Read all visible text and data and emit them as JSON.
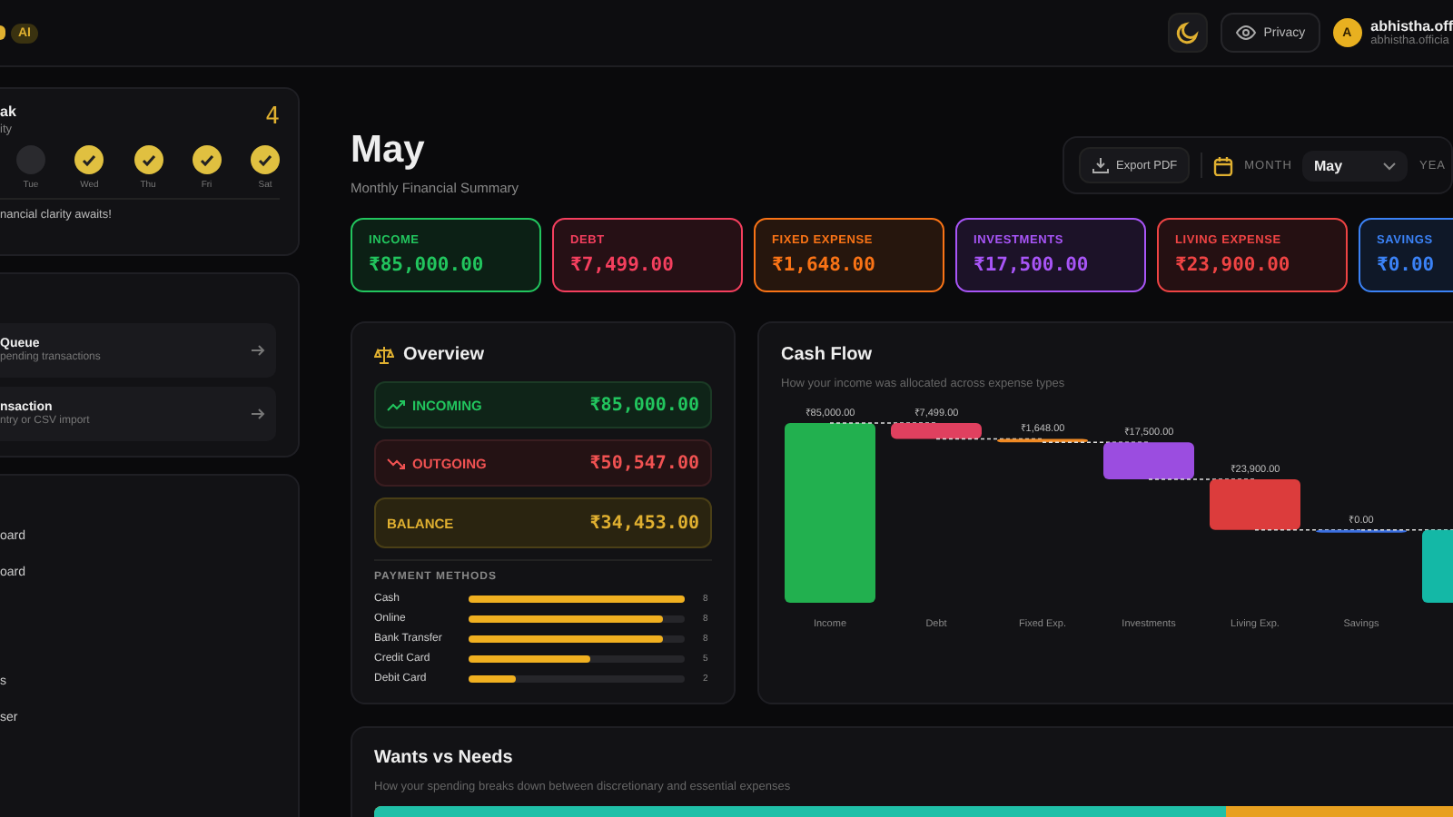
{
  "topbar": {
    "badge": "AI",
    "privacy": "Privacy",
    "avatar": "A",
    "user_name": "abhistha.off",
    "user_email": "abhistha.officia"
  },
  "streak": {
    "title": "ak",
    "subtitle": "ity",
    "count": "4",
    "days": [
      {
        "label": "Tue",
        "checked": false
      },
      {
        "label": "Wed",
        "checked": true
      },
      {
        "label": "Thu",
        "checked": true
      },
      {
        "label": "Fri",
        "checked": true
      },
      {
        "label": "Sat",
        "checked": true
      }
    ],
    "message": "nancial clarity awaits!"
  },
  "actions": [
    {
      "title": "Queue",
      "subtitle": "pending transactions"
    },
    {
      "title": "nsaction",
      "subtitle": "ntry or CSV import"
    }
  ],
  "nav": {
    "items": [
      "oard",
      "oard",
      "s",
      "ser"
    ]
  },
  "header": {
    "title": "May",
    "subtitle": "Monthly Financial Summary"
  },
  "toolbar": {
    "export": "Export PDF",
    "month_label": "MONTH",
    "month": "May",
    "year_label": "YEA"
  },
  "stats": [
    {
      "label": "INCOME",
      "value": "₹85,000.00",
      "color": "#22c55e"
    },
    {
      "label": "DEBT",
      "value": "₹7,499.00",
      "color": "#f43f5e"
    },
    {
      "label": "FIXED EXPENSE",
      "value": "₹1,648.00",
      "color": "#f97316"
    },
    {
      "label": "INVESTMENTS",
      "value": "₹17,500.00",
      "color": "#a855f7"
    },
    {
      "label": "LIVING EXPENSE",
      "value": "₹23,900.00",
      "color": "#ef4444"
    },
    {
      "label": "SAVINGS",
      "value": "₹0.00",
      "color": "#3b82f6"
    }
  ],
  "overview": {
    "title": "Overview",
    "rows": [
      {
        "kind": "incoming",
        "label": "INCOMING",
        "value": "₹85,000.00"
      },
      {
        "kind": "outgoing",
        "label": "OUTGOING",
        "value": "₹50,547.00"
      },
      {
        "kind": "balance",
        "label": "BALANCE",
        "value": "₹34,453.00"
      }
    ],
    "methods_title": "PAYMENT METHODS",
    "methods": [
      {
        "name": "Cash",
        "count": "8",
        "level": 1
      },
      {
        "name": "Online",
        "count": "8",
        "level": 0.9
      },
      {
        "name": "Bank Transfer",
        "count": "8",
        "level": 0.9
      },
      {
        "name": "Credit Card",
        "count": "5",
        "level": 0.56
      },
      {
        "name": "Debit Card",
        "count": "2",
        "level": 0.22
      }
    ]
  },
  "cash_flow": {
    "title": "Cash Flow",
    "subtitle": "How your income was allocated across expense types",
    "bars": [
      {
        "kind": "total",
        "category": "Income",
        "amount": "₹85,000.00",
        "color": "#22b04f"
      },
      {
        "kind": "step",
        "category": "Debt",
        "amount": "₹7,499.00",
        "color": "#e0405f"
      },
      {
        "kind": "step",
        "category": "Fixed Exp.",
        "amount": "₹1,648.00",
        "color": "#f08a24"
      },
      {
        "kind": "step",
        "category": "Investments",
        "amount": "₹17,500.00",
        "color": "#9b4de0"
      },
      {
        "kind": "step",
        "category": "Living Exp.",
        "amount": "₹23,900.00",
        "color": "#dc3c3c"
      },
      {
        "kind": "step",
        "category": "Savings",
        "amount": "₹0.00",
        "color": "#3b6fe0"
      },
      {
        "kind": "remaining",
        "color": "#14b8a6"
      }
    ]
  },
  "wants_needs": {
    "title": "Wants vs Needs",
    "subtitle": "How your spending breaks down between discretionary and essential expenses",
    "level": 0.74
  }
}
